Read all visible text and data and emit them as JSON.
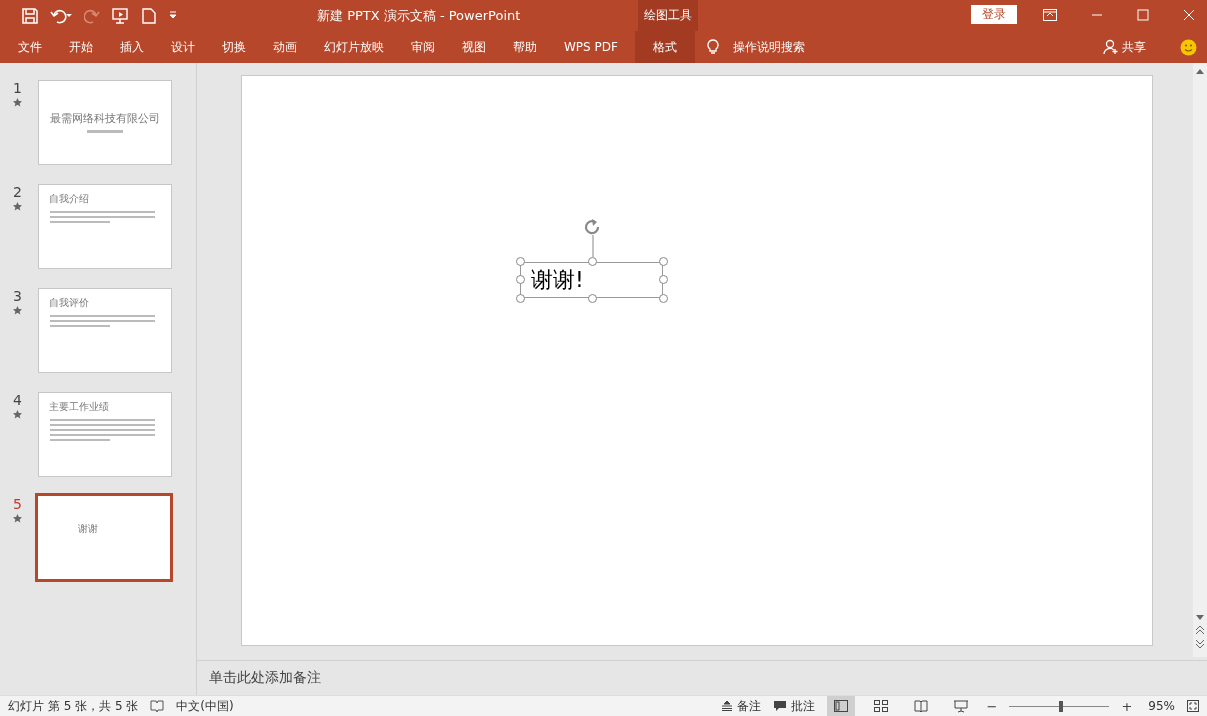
{
  "window": {
    "title": "新建 PPTX 演示文稿  -  PowerPoint",
    "context_tab": "绘图工具",
    "login": "登录"
  },
  "ribbon": {
    "tabs": [
      {
        "label": "文件",
        "selected": false
      },
      {
        "label": "开始",
        "selected": false
      },
      {
        "label": "插入",
        "selected": false
      },
      {
        "label": "设计",
        "selected": false
      },
      {
        "label": "切换",
        "selected": false
      },
      {
        "label": "动画",
        "selected": false
      },
      {
        "label": "幻灯片放映",
        "selected": false
      },
      {
        "label": "审阅",
        "selected": false
      },
      {
        "label": "视图",
        "selected": false
      },
      {
        "label": "帮助",
        "selected": false
      },
      {
        "label": "WPS PDF",
        "selected": false
      },
      {
        "label": "格式",
        "selected": true
      }
    ],
    "search": "操作说明搜索",
    "share": "共享"
  },
  "slides": [
    {
      "number": "1",
      "title": "最需网络科技有限公司",
      "kind": "title",
      "selected": false
    },
    {
      "number": "2",
      "title": "自我介绍",
      "kind": "content",
      "selected": false
    },
    {
      "number": "3",
      "title": "自我评价",
      "kind": "content",
      "selected": false
    },
    {
      "number": "4",
      "title": "主要工作业绩",
      "kind": "content",
      "selected": false
    },
    {
      "number": "5",
      "title": "谢谢",
      "kind": "end",
      "selected": true
    }
  ],
  "canvas": {
    "textbox": "谢谢!"
  },
  "notes": {
    "placeholder": "单击此处添加备注"
  },
  "status_bar": {
    "slide_info": "幻灯片 第 5 张，共 5 张",
    "language": "中文(中国)",
    "notes": "备注",
    "comments": "批注",
    "zoom_out": "−",
    "zoom_in": "+",
    "zoom": "95%",
    "level": 0.5
  }
}
